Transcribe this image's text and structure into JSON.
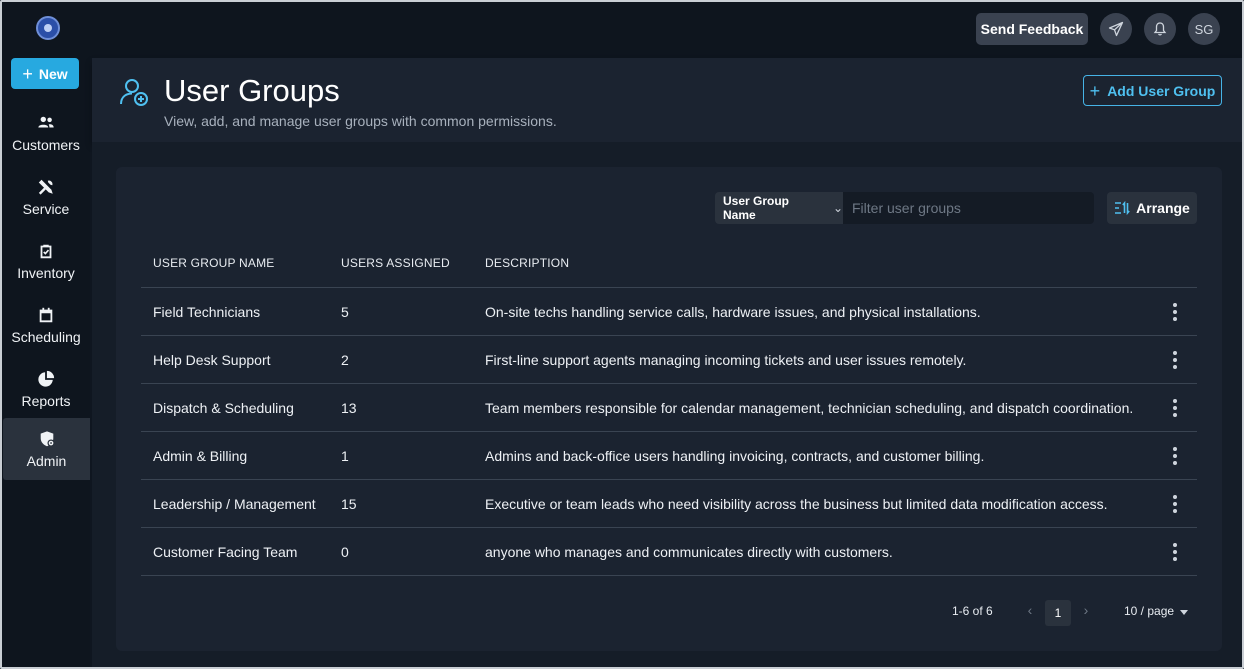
{
  "topbar": {
    "feedback_label": "Send Feedback",
    "avatar_initials": "SG"
  },
  "sidebar": {
    "new_label": "New",
    "items": [
      {
        "label": "Customers",
        "icon": "users-icon"
      },
      {
        "label": "Service",
        "icon": "tools-icon"
      },
      {
        "label": "Inventory",
        "icon": "clipboard-check-icon"
      },
      {
        "label": "Scheduling",
        "icon": "calendar-icon"
      },
      {
        "label": "Reports",
        "icon": "pie-chart-icon"
      },
      {
        "label": "Admin",
        "icon": "shield-gear-icon",
        "active": true
      }
    ]
  },
  "header": {
    "title": "User Groups",
    "subtitle": "View, add, and manage user groups with common permissions.",
    "add_label": "Add User Group"
  },
  "toolbar": {
    "filter_field": "User Group Name",
    "filter_placeholder": "Filter user groups",
    "arrange_label": "Arrange"
  },
  "table": {
    "columns": [
      "USER GROUP NAME",
      "USERS ASSIGNED",
      "DESCRIPTION"
    ],
    "rows": [
      {
        "name": "Field Technicians",
        "users": "5",
        "description": "On-site techs handling service calls, hardware issues, and physical installations."
      },
      {
        "name": "Help Desk Support",
        "users": "2",
        "description": "First-line support agents managing incoming tickets and user issues remotely."
      },
      {
        "name": "Dispatch & Scheduling",
        "users": "13",
        "description": "Team members responsible for calendar management, technician scheduling, and dispatch coordination."
      },
      {
        "name": "Admin & Billing",
        "users": "1",
        "description": "Admins and back-office users handling invoicing, contracts, and customer billing."
      },
      {
        "name": "Leadership / Management",
        "users": "15",
        "description": "Executive or team leads who need visibility across the business but limited data modification access."
      },
      {
        "name": "Customer Facing Team",
        "users": "0",
        "description": "anyone who manages and communicates directly with customers."
      }
    ]
  },
  "pagination": {
    "range": "1-6 of 6",
    "current_page": "1",
    "per_page": "10 / page"
  },
  "colors": {
    "accent": "#27a9e0",
    "background": "#0f1620",
    "card": "#1b2330"
  }
}
